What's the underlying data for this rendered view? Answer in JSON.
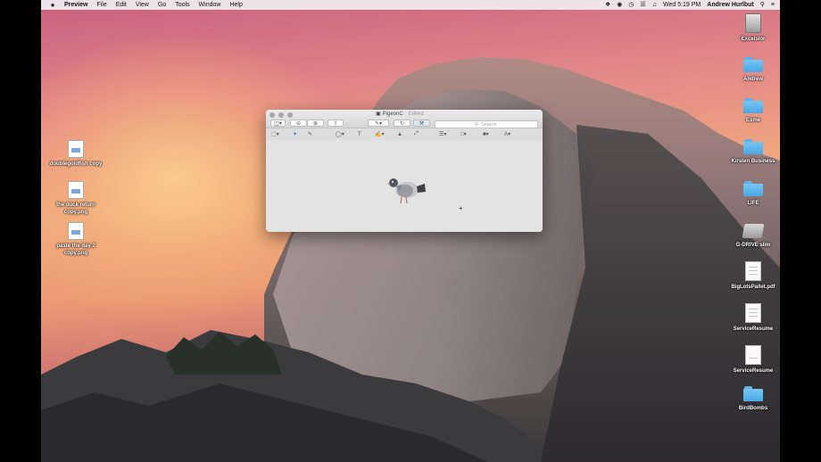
{
  "menubar": {
    "app": "Preview",
    "items": [
      "File",
      "Edit",
      "View",
      "Go",
      "Tools",
      "Window",
      "Help"
    ],
    "datetime": "Wed 5:19 PM",
    "user": "Andrew Hurlbut"
  },
  "desktop_left": [
    {
      "label": "doublegoldfish copy"
    },
    {
      "label": "the duck return copy.png"
    },
    {
      "label": "paste the day 2 copy.png"
    }
  ],
  "desktop_right": [
    {
      "label": "Excelsior",
      "icon": "drive-icon"
    },
    {
      "label": "Andrew",
      "icon": "folder-icon"
    },
    {
      "label": "Esme",
      "icon": "folder-icon"
    },
    {
      "label": "Kirsten Business",
      "icon": "folder-icon"
    },
    {
      "label": "LIFE",
      "icon": "folder-icon"
    },
    {
      "label": "G-DRIVE slim",
      "icon": "external-drive-icon"
    },
    {
      "label": "BigLotsPallet.pdf",
      "icon": "pdf-icon"
    },
    {
      "label": "ServiceResume",
      "icon": "document-icon"
    },
    {
      "label": "ServiceResume",
      "icon": "document-icon"
    },
    {
      "label": "BirdBombs",
      "icon": "folder-icon"
    }
  ],
  "window": {
    "title": "PigeonC",
    "status": "Edited",
    "search_placeholder": "Search"
  }
}
